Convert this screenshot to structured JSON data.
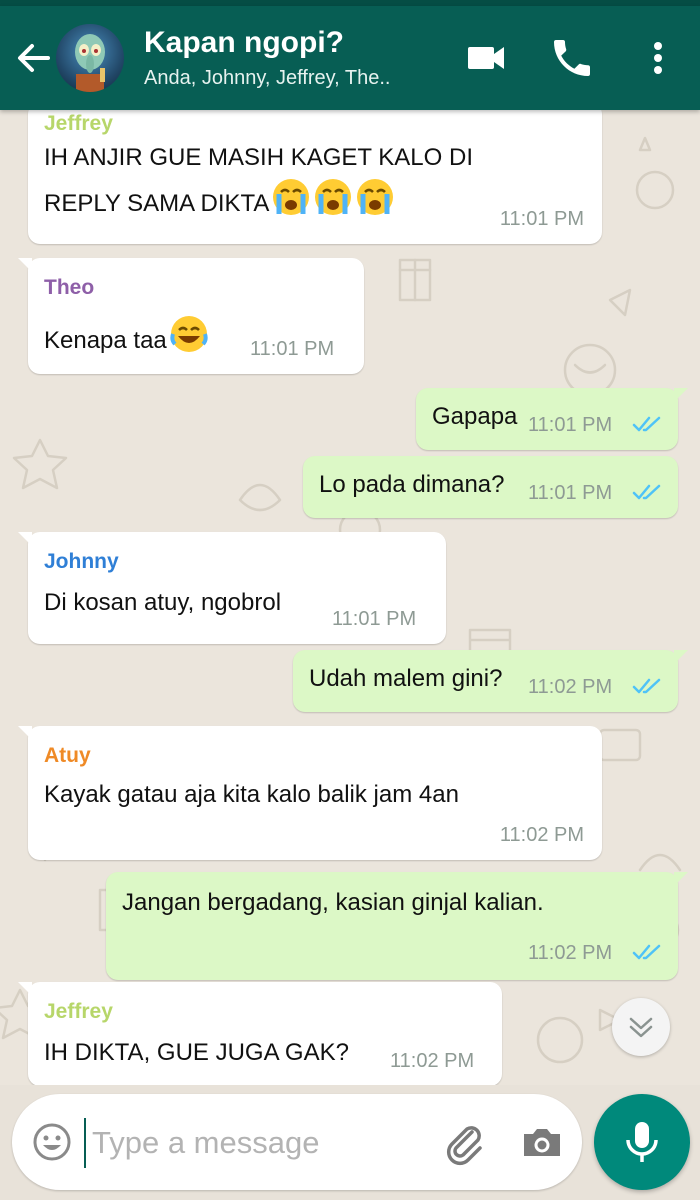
{
  "header": {
    "title": "Kapan ngopi?",
    "subtitle": "Anda, Johnny, Jeffrey, The..",
    "icons": {
      "back": "arrow-left-icon",
      "avatar": "group-avatar",
      "video": "video-camera-icon",
      "call": "phone-icon",
      "menu": "more-vertical-icon"
    }
  },
  "colors": {
    "header": "#075e54",
    "incoming_bubble": "#ffffff",
    "outgoing_bubble": "#dcf8c6",
    "read_ticks": "#4fc3f7",
    "mic_button": "#00897b",
    "sender_jeffrey": "#b7d66a",
    "sender_theo": "#8e5fa8",
    "sender_johnny": "#2f7fd6",
    "sender_atuy": "#ef8a26"
  },
  "messages": [
    {
      "direction": "in",
      "sender": "Jeffrey",
      "text_line1": "IH ANJIR GUE MASIH KAGET KALO DI",
      "text_line2": "REPLY SAMA DIKTA",
      "emoji": "loudly-crying-face x3",
      "time": "11:01 PM"
    },
    {
      "direction": "in",
      "sender": "Theo",
      "text": "Kenapa taa",
      "emoji": "face-with-tears-of-joy",
      "time": "11:01 PM"
    },
    {
      "direction": "out",
      "text": "Gapapa",
      "time": "11:01 PM",
      "status": "read"
    },
    {
      "direction": "out",
      "text": "Lo pada dimana?",
      "time": "11:01 PM",
      "status": "read"
    },
    {
      "direction": "in",
      "sender": "Johnny",
      "text": "Di kosan atuy, ngobrol",
      "time": "11:01 PM"
    },
    {
      "direction": "out",
      "text": "Udah malem gini?",
      "time": "11:02 PM",
      "status": "read"
    },
    {
      "direction": "in",
      "sender": "Atuy",
      "text": "Kayak gatau aja kita kalo balik jam 4an",
      "time": "11:02 PM"
    },
    {
      "direction": "out",
      "text": "Jangan bergadang, kasian ginjal kalian.",
      "time": "11:02 PM",
      "status": "read"
    },
    {
      "direction": "in",
      "sender": "Jeffrey",
      "text": "IH DIKTA, GUE JUGA GAK?",
      "time": "11:02 PM"
    }
  ],
  "scroll_button": {
    "icon": "double-chevron-down-icon"
  },
  "composer": {
    "placeholder": "Type a message",
    "value": "",
    "icons": {
      "emoji": "smiley-icon",
      "attach": "paperclip-icon",
      "camera": "camera-icon",
      "mic": "microphone-icon"
    }
  }
}
